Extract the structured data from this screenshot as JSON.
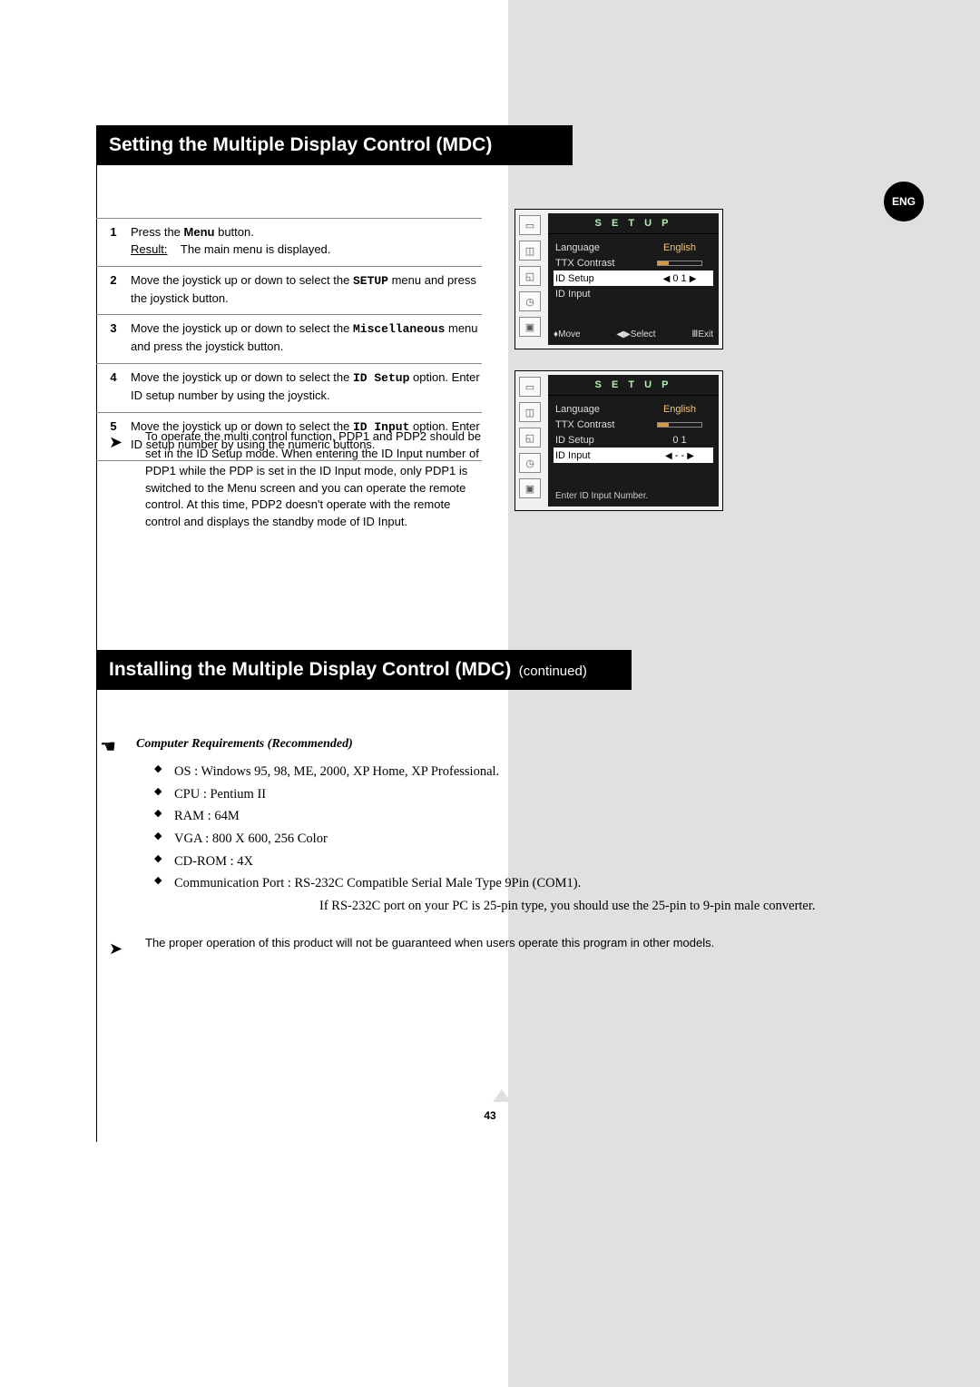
{
  "lang_badge": "ENG",
  "title1": "Setting the Multiple Display Control (MDC)",
  "title2": "Installing the Multiple Display Control (MDC)",
  "title2_cont": "(continued)",
  "steps": [
    {
      "num": "1",
      "pre": "Press the ",
      "bold": "Menu",
      "post": " button.",
      "result_label": "Result:",
      "result_text": "The main menu is displayed."
    },
    {
      "num": "2",
      "pre": "Move the joystick up or down to select the ",
      "mono": "SETUP",
      "post": " menu and press the joystick button."
    },
    {
      "num": "3",
      "pre": "Move the joystick up or down to select the ",
      "mono": "Miscellaneous",
      "post": " menu and press the joystick button."
    },
    {
      "num": "4",
      "pre": "Move the joystick up or down to select the ",
      "mono": "ID Setup",
      "post": " option. Enter ID setup number by using the joystick."
    },
    {
      "num": "5",
      "pre": "Move the joystick up or down to select the ",
      "mono": "ID Input",
      "post": " option. Enter ID setup number by using the numeric buttons."
    }
  ],
  "note1": "To operate the multi control function, PDP1 and PDP2 should be set in the ID Setup mode. When entering the ID Input number of PDP1 while the PDP is set in the ID Input mode, only PDP1 is switched to the Menu screen and you can operate the remote control. At this time, PDP2 doesn't operate with the remote control and displays the standby mode of ID Input.",
  "osd": {
    "header": "S E T U P",
    "rows": {
      "lang": {
        "label": "Language",
        "value": "English"
      },
      "ttx": {
        "label": "TTX Contrast"
      },
      "idsetup": {
        "label": "ID Setup",
        "value": "0 1"
      },
      "idinput": {
        "label": "ID Input",
        "value": "- -"
      }
    },
    "footer": {
      "move": "Move",
      "select": "Select",
      "exit": "Exit"
    },
    "hint2": "Enter ID Input Number.",
    "icons": [
      "▭",
      "◫",
      "◱",
      "◷",
      "▣"
    ]
  },
  "req_heading": "Computer Requirements (Recommended)",
  "reqs": [
    "OS : Windows 95, 98, ME, 2000, XP Home, XP Professional.",
    "CPU : Pentium II",
    "RAM : 64M",
    "VGA : 800 X 600, 256 Color",
    "CD-ROM : 4X"
  ],
  "req_comm_line1": "Communication Port : RS-232C Compatible Serial Male Type 9Pin (COM1).",
  "req_comm_line2": "If RS-232C port on your PC is 25-pin type, you should use the 25-pin to 9-pin male converter.",
  "note2": "The proper operation of this product will not be guaranteed when users operate this program in other models.",
  "page_number": "43"
}
